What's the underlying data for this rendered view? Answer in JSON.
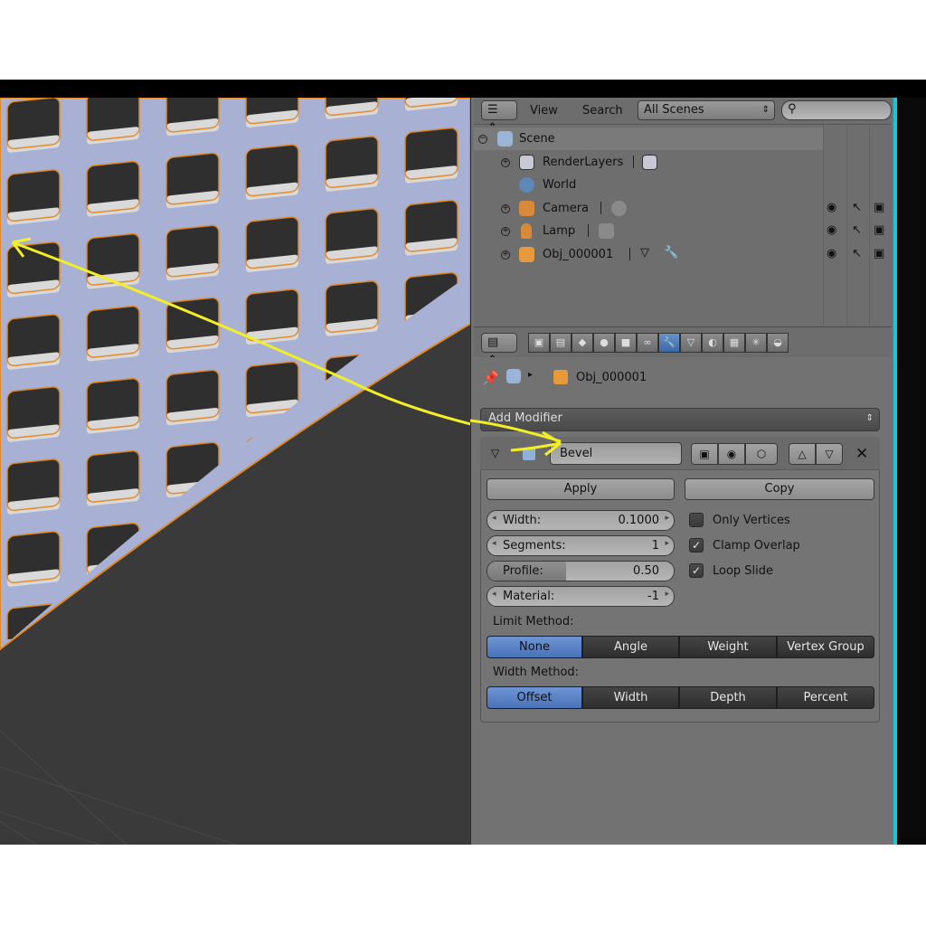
{
  "outliner": {
    "header": {
      "view": "View",
      "search": "Search",
      "scenes": "All Scenes"
    },
    "tree": {
      "scene": "Scene",
      "renderlayers": "RenderLayers",
      "world": "World",
      "camera": "Camera",
      "lamp": "Lamp",
      "object": "Obj_000001"
    }
  },
  "properties": {
    "breadcrumb": "Obj_000001",
    "add_modifier": "Add Modifier",
    "modifier": {
      "name": "Bevel",
      "apply": "Apply",
      "copy": "Copy",
      "width_label": "Width:",
      "width_value": "0.1000",
      "segments_label": "Segments:",
      "segments_value": "1",
      "profile_label": "Profile:",
      "profile_value": "0.50",
      "profile_fraction": 0.5,
      "material_label": "Material:",
      "material_value": "-1",
      "only_vertices": "Only Vertices",
      "only_vertices_checked": false,
      "clamp_overlap": "Clamp Overlap",
      "clamp_overlap_checked": true,
      "loop_slide": "Loop Slide",
      "loop_slide_checked": true,
      "limit_method_label": "Limit Method:",
      "limit_methods": [
        "None",
        "Angle",
        "Weight",
        "Vertex Group"
      ],
      "limit_selected": "None",
      "width_method_label": "Width Method:",
      "width_methods": [
        "Offset",
        "Width",
        "Depth",
        "Percent"
      ],
      "width_selected": "Offset"
    }
  },
  "colors": {
    "accent_selected": "#5b83c6",
    "annotation_arrow": "#f2ef2a",
    "mesh": "#a8b0d4",
    "cyan_edge": "#18c6d8"
  },
  "icons": [
    "editor-type-icon",
    "search-icon",
    "scene-icon",
    "renderlayers-icon",
    "world-icon",
    "camera-icon",
    "lamp-icon",
    "mesh-object-icon",
    "eye-icon",
    "cursor-icon",
    "render-icon",
    "wrench-icon",
    "pin-icon",
    "cube-icon",
    "close-icon"
  ]
}
